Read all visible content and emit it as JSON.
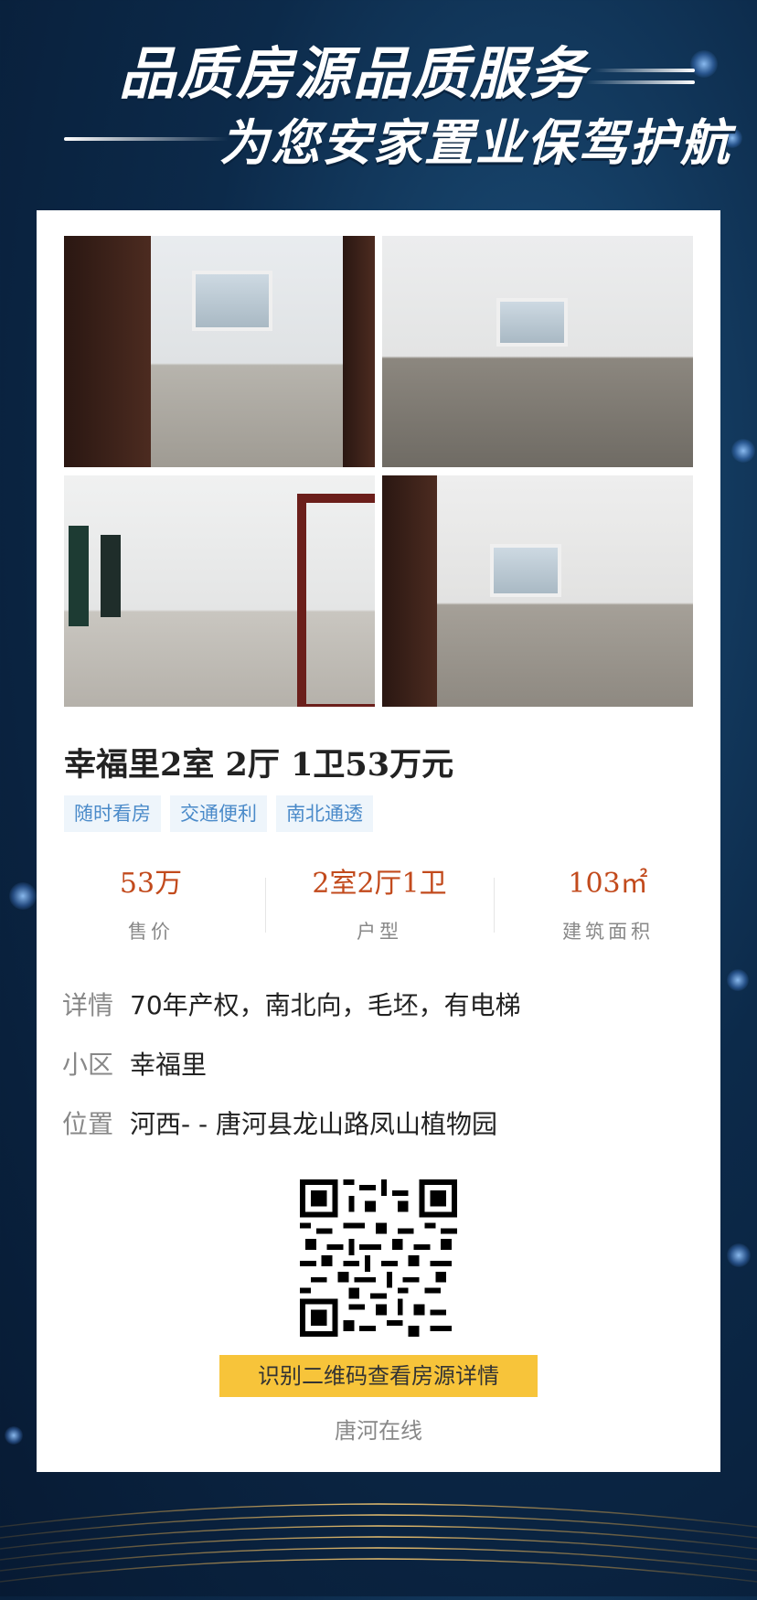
{
  "banner": {
    "line1": "品质房源品质服务",
    "line2": "为您安家置业保驾护航"
  },
  "listing": {
    "title": "幸福里2室 2厅 1卫53万元",
    "tags": [
      "随时看房",
      "交通便利",
      "南北通透"
    ],
    "stats": [
      {
        "value": "53万",
        "label": "售价"
      },
      {
        "value": "2室2厅1卫",
        "label": "户型"
      },
      {
        "value": "103㎡",
        "label": "建筑面积"
      }
    ],
    "details": {
      "detail_key": "详情",
      "detail_value": "70年产权，南北向，毛坯，有电梯",
      "community_key": "小区",
      "community_value": "幸福里",
      "location_key": "位置",
      "location_value": "河西- - 唐河县龙山路凤山植物园"
    },
    "cta_label": "识别二维码查看房源详情",
    "brand": "唐河在线"
  },
  "colors": {
    "accent": "#c24a1c",
    "tag_text": "#4a8ac9",
    "cta_bg": "#f7c43a"
  }
}
